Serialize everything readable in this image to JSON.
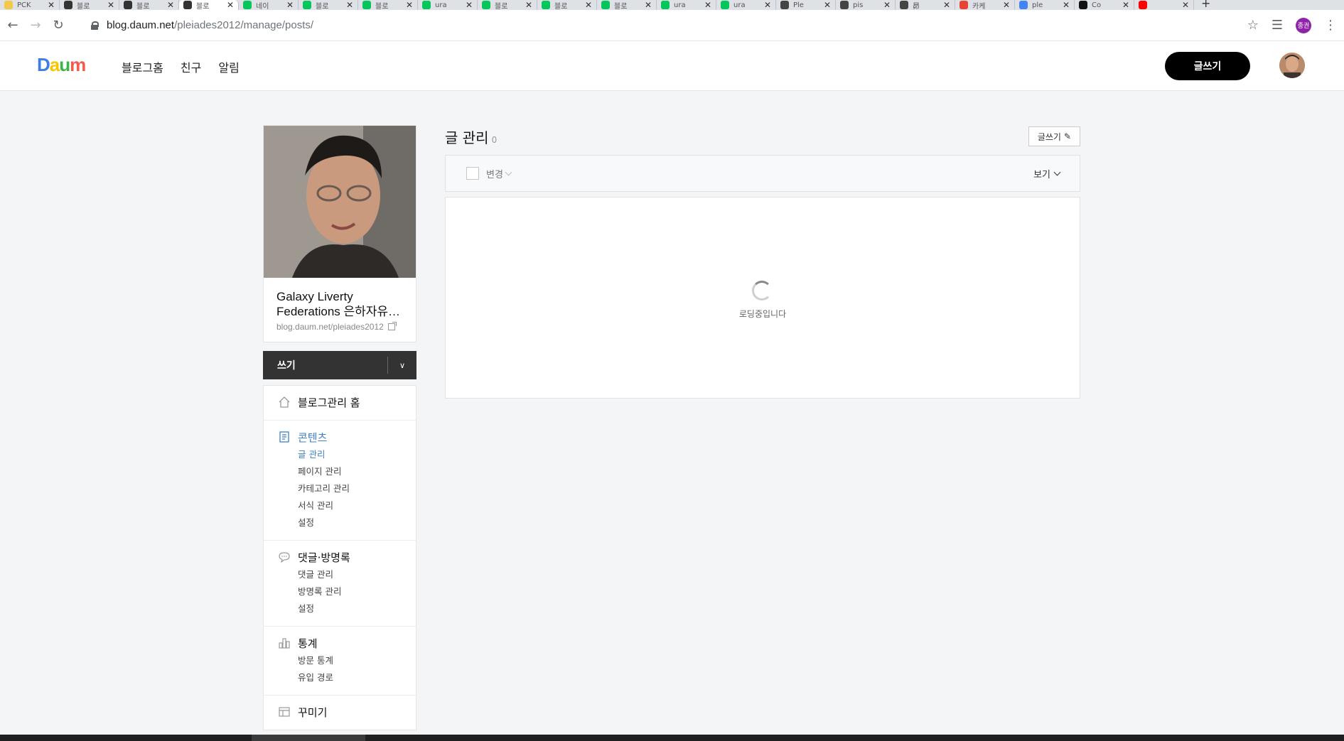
{
  "browser": {
    "tabs": [
      {
        "title": "PCK",
        "color": "#f2c94c",
        "active": false
      },
      {
        "title": "블로",
        "color": "#333333",
        "active": false
      },
      {
        "title": "블로",
        "color": "#333333",
        "active": false
      },
      {
        "title": "블로",
        "color": "#333333",
        "active": true
      },
      {
        "title": "네이",
        "color": "#03c75a",
        "active": false
      },
      {
        "title": "블로",
        "color": "#03c75a",
        "active": false
      },
      {
        "title": "블로",
        "color": "#03c75a",
        "active": false
      },
      {
        "title": "ura",
        "color": "#03c75a",
        "active": false
      },
      {
        "title": "블로",
        "color": "#03c75a",
        "active": false
      },
      {
        "title": "블로",
        "color": "#03c75a",
        "active": false
      },
      {
        "title": "블로",
        "color": "#03c75a",
        "active": false
      },
      {
        "title": "ura",
        "color": "#03c75a",
        "active": false
      },
      {
        "title": "ura",
        "color": "#03c75a",
        "active": false
      },
      {
        "title": "Ple",
        "color": "#444444",
        "active": false
      },
      {
        "title": "pis",
        "color": "#444444",
        "active": false
      },
      {
        "title": "昴",
        "color": "#444444",
        "active": false
      },
      {
        "title": "카케",
        "color": "#ea4335",
        "active": false
      },
      {
        "title": "ple",
        "color": "#4285f4",
        "active": false
      },
      {
        "title": "Co",
        "color": "#111111",
        "active": false
      },
      {
        "title": "",
        "color": "#ff0000",
        "active": false
      }
    ],
    "url_host": "blog.daum.net",
    "url_path": "/pleiades2012/manage/posts/",
    "profile_initials": "종권"
  },
  "header": {
    "logo": {
      "d": "D",
      "a": "a",
      "u": "u",
      "m": "m"
    },
    "nav": [
      "블로그홈",
      "친구",
      "알림"
    ],
    "write_button": "글쓰기"
  },
  "sidebar": {
    "blog_title": "Galaxy Liverty Federations 은하자유…",
    "blog_url": "blog.daum.net/pleiades2012",
    "write_bar": "쓰기",
    "sections": [
      {
        "icon": "home-icon",
        "title": "블로그관리 홈",
        "active": false,
        "items": []
      },
      {
        "icon": "document-icon",
        "title": "콘텐츠",
        "active": true,
        "items": [
          {
            "label": "글 관리",
            "active": true
          },
          {
            "label": "페이지 관리",
            "active": false
          },
          {
            "label": "카테고리 관리",
            "active": false
          },
          {
            "label": "서식 관리",
            "active": false
          },
          {
            "label": "설정",
            "active": false
          }
        ]
      },
      {
        "icon": "comment-icon",
        "title": "댓글·방명록",
        "active": false,
        "items": [
          {
            "label": "댓글 관리",
            "active": false
          },
          {
            "label": "방명록 관리",
            "active": false
          },
          {
            "label": "설정",
            "active": false
          }
        ]
      },
      {
        "icon": "chart-icon",
        "title": "통계",
        "active": false,
        "items": [
          {
            "label": "방문 통계",
            "active": false
          },
          {
            "label": "유입 경로",
            "active": false
          }
        ]
      },
      {
        "icon": "layout-icon",
        "title": "꾸미기",
        "active": false,
        "items": []
      }
    ]
  },
  "main": {
    "title": "글 관리",
    "count": "0",
    "write_small": "글쓰기",
    "filter_change": "변경",
    "view_label": "보기",
    "loading_text": "로딩중입니다"
  },
  "colors": {
    "accent": "#3f7fc5",
    "write_button_bg": "#000000",
    "page_bg": "#f4f5f7"
  }
}
